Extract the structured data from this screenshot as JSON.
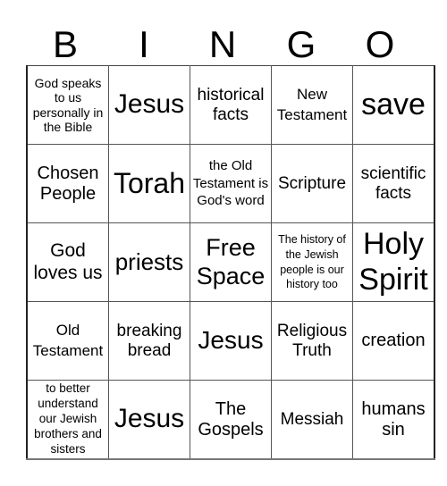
{
  "header": {
    "letters": [
      "B",
      "I",
      "N",
      "G",
      "O"
    ]
  },
  "card": {
    "rows": [
      [
        "God speaks to us personally in the Bible",
        "Jesus",
        "historical facts",
        "New Testament",
        "save"
      ],
      [
        "Chosen People",
        "Torah",
        "the Old Testament is God's word",
        "Scripture",
        "scientific facts"
      ],
      [
        "God loves us",
        "priests",
        "Free Space",
        "The history of the Jewish people is our history too",
        "Holy Spirit"
      ],
      [
        "Old Testament",
        "breaking bread",
        "Jesus",
        "Religious Truth",
        "creation"
      ],
      [
        "to better understand our Jewish brothers and sisters",
        "Jesus",
        "The Gospels",
        "Messiah",
        "humans sin"
      ]
    ]
  }
}
